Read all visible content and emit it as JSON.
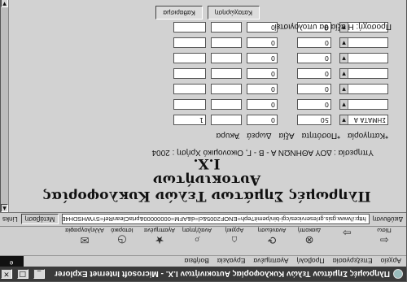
{
  "window": {
    "title": "Πληρωμές Σημάτων Τελών Κυκλοφορίας Αυτοκινήτων Ι.Χ. - Microsoft Internet Explorer",
    "buttons": {
      "minimize": "_",
      "maximize": "□",
      "close": "×"
    }
  },
  "menu": {
    "items": [
      "Αρχείο",
      "Επεξεργασία",
      "Προβολή",
      "Αγαπημένα",
      "Εργαλεία",
      "Βοήθεια"
    ],
    "logo": "e"
  },
  "toolbar": {
    "buttons": [
      {
        "label": "Πίσω",
        "icon": "back-arrow-icon",
        "glyph": "⇦"
      },
      {
        "label": "",
        "icon": "forward-arrow-icon",
        "glyph": "⇨"
      },
      {
        "label": "Διακοπή",
        "icon": "stop-icon",
        "glyph": "⊗"
      },
      {
        "label": "Ανανέωση",
        "icon": "refresh-icon",
        "glyph": "⟳"
      },
      {
        "label": "Αρχική",
        "icon": "home-icon",
        "glyph": "⌂"
      },
      {
        "label": "Αναζήτηση",
        "icon": "search-icon",
        "glyph": "⌕"
      },
      {
        "label": "Αγαπημένα",
        "icon": "favorites-icon",
        "glyph": "★"
      },
      {
        "label": "Ιστορικό",
        "icon": "history-icon",
        "glyph": "◷"
      },
      {
        "label": "Αλληλογραφία",
        "icon": "mail-icon",
        "glyph": "✉"
      }
    ]
  },
  "address": {
    "label": "Διεύθυνση",
    "value": "http://www.gsis.gr/eservices/cgi-bin/pemit?eph=ENOF2005&cl=d&AFM=00000000&prtaCleanRef=SYWHSDH4EDE",
    "go_label": "Μετάβαση",
    "links_label": "Links"
  },
  "page": {
    "heading_line1": "Πληρωμές Σημάτων Τελών Κυκλοφορίας Αυτοκινήτων",
    "heading_line2": "Ι.Χ.",
    "service_line": "Υπηρεσία : ΔΟΥ ΑΘΗΝΩΝ Α - Β - Γ,   Οικονομικό Χρήση : 2004",
    "columns": [
      "*Κατηγορία",
      "*Ποσότητα",
      "Αξία",
      "Δωρεά",
      "Άκυρα"
    ],
    "rows": [
      {
        "category": "ΣΗΜΑΤΑ Α",
        "qty": "50",
        "value": "0",
        "donation": "",
        "void": "1"
      },
      {
        "category": "",
        "qty": "0",
        "value": "0",
        "donation": "",
        "void": ""
      },
      {
        "category": "",
        "qty": "0",
        "value": "0",
        "donation": "",
        "void": ""
      },
      {
        "category": "",
        "qty": "0",
        "value": "0",
        "donation": "",
        "void": ""
      },
      {
        "category": "",
        "qty": "0",
        "value": "0",
        "donation": "",
        "void": ""
      },
      {
        "category": "",
        "qty": "0",
        "value": "0",
        "donation": "",
        "void": ""
      },
      {
        "category": "",
        "qty": "0",
        "value": "0",
        "donation": "",
        "void": ""
      }
    ],
    "warning": "Προσοχή: Η αξία θα υπολογιστεί",
    "tabs": [
      "Καταχώρηση",
      "Καθαρισμα"
    ]
  }
}
